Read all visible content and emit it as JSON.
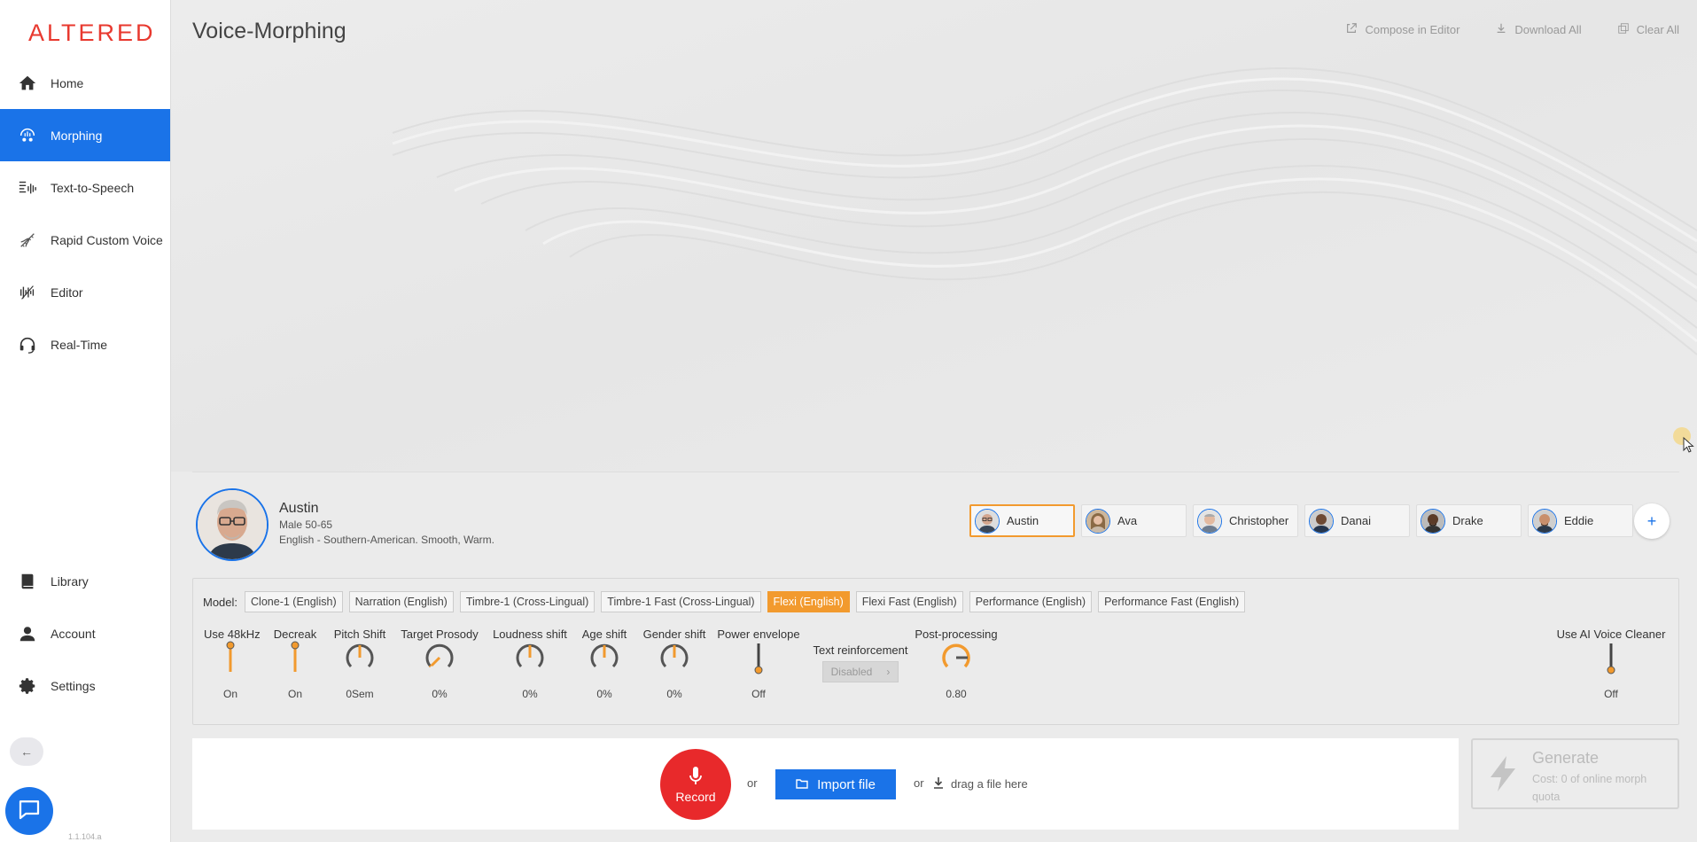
{
  "app": {
    "logo": "ALTERED",
    "version": "1.1.104.a"
  },
  "sidebar": {
    "items": [
      {
        "label": "Home",
        "icon": "home-icon"
      },
      {
        "label": "Morphing",
        "icon": "morphing-icon",
        "active": true
      },
      {
        "label": "Text-to-Speech",
        "icon": "tts-icon"
      },
      {
        "label": "Rapid Custom Voice",
        "icon": "dna-icon"
      },
      {
        "label": "Editor",
        "icon": "editor-icon"
      },
      {
        "label": "Real-Time",
        "icon": "headset-icon"
      }
    ],
    "bottom_items": [
      {
        "label": "Library",
        "icon": "book-icon"
      },
      {
        "label": "Account",
        "icon": "person-icon"
      },
      {
        "label": "Settings",
        "icon": "gear-icon"
      }
    ],
    "collapse_label": "←"
  },
  "header": {
    "title": "Voice-Morphing",
    "actions": [
      "Compose in Editor",
      "Download All",
      "Clear All"
    ]
  },
  "voice": {
    "name": "Austin",
    "meta": "Male 50-65",
    "description": "English - Southern-American. Smooth, Warm."
  },
  "voice_list": [
    "Austin",
    "Ava",
    "Christopher",
    "Danai",
    "Drake",
    "Eddie"
  ],
  "selected_voice": "Austin",
  "add_voice_label": "+",
  "model": {
    "label": "Model:",
    "options": [
      "Clone-1 (English)",
      "Narration (English)",
      "Timbre-1 (Cross-Lingual)",
      "Timbre-1 Fast (Cross-Lingual)",
      "Flexi (English)",
      "Flexi Fast (English)",
      "Performance (English)",
      "Performance Fast (English)"
    ],
    "selected": "Flexi (English)"
  },
  "controls": {
    "use48": {
      "label": "Use 48kHz",
      "value": "On"
    },
    "decreak": {
      "label": "Decreak",
      "value": "On"
    },
    "pitch": {
      "label": "Pitch Shift",
      "value": "0Sem"
    },
    "prosody": {
      "label": "Target Prosody",
      "value": "0%"
    },
    "loudness": {
      "label": "Loudness shift",
      "value": "0%"
    },
    "age": {
      "label": "Age shift",
      "value": "0%"
    },
    "gender": {
      "label": "Gender shift",
      "value": "0%"
    },
    "power": {
      "label": "Power envelope",
      "value": "Off"
    },
    "text_reinf": {
      "label": "Text reinforcement",
      "value": "Disabled"
    },
    "post": {
      "label": "Post-processing",
      "value": "0.80"
    },
    "cleaner": {
      "label": "Use AI Voice Cleaner",
      "value": "Off"
    }
  },
  "input": {
    "record_label": "Record",
    "or": "or",
    "import_label": "Import file",
    "drag_label": "drag a file here"
  },
  "generate": {
    "title": "Generate",
    "cost": "Cost: 0 of online morph quota"
  },
  "colors": {
    "accent": "#1a73e8",
    "orange": "#f29a2e",
    "record": "#e8292b",
    "logo": "#e8392f"
  }
}
